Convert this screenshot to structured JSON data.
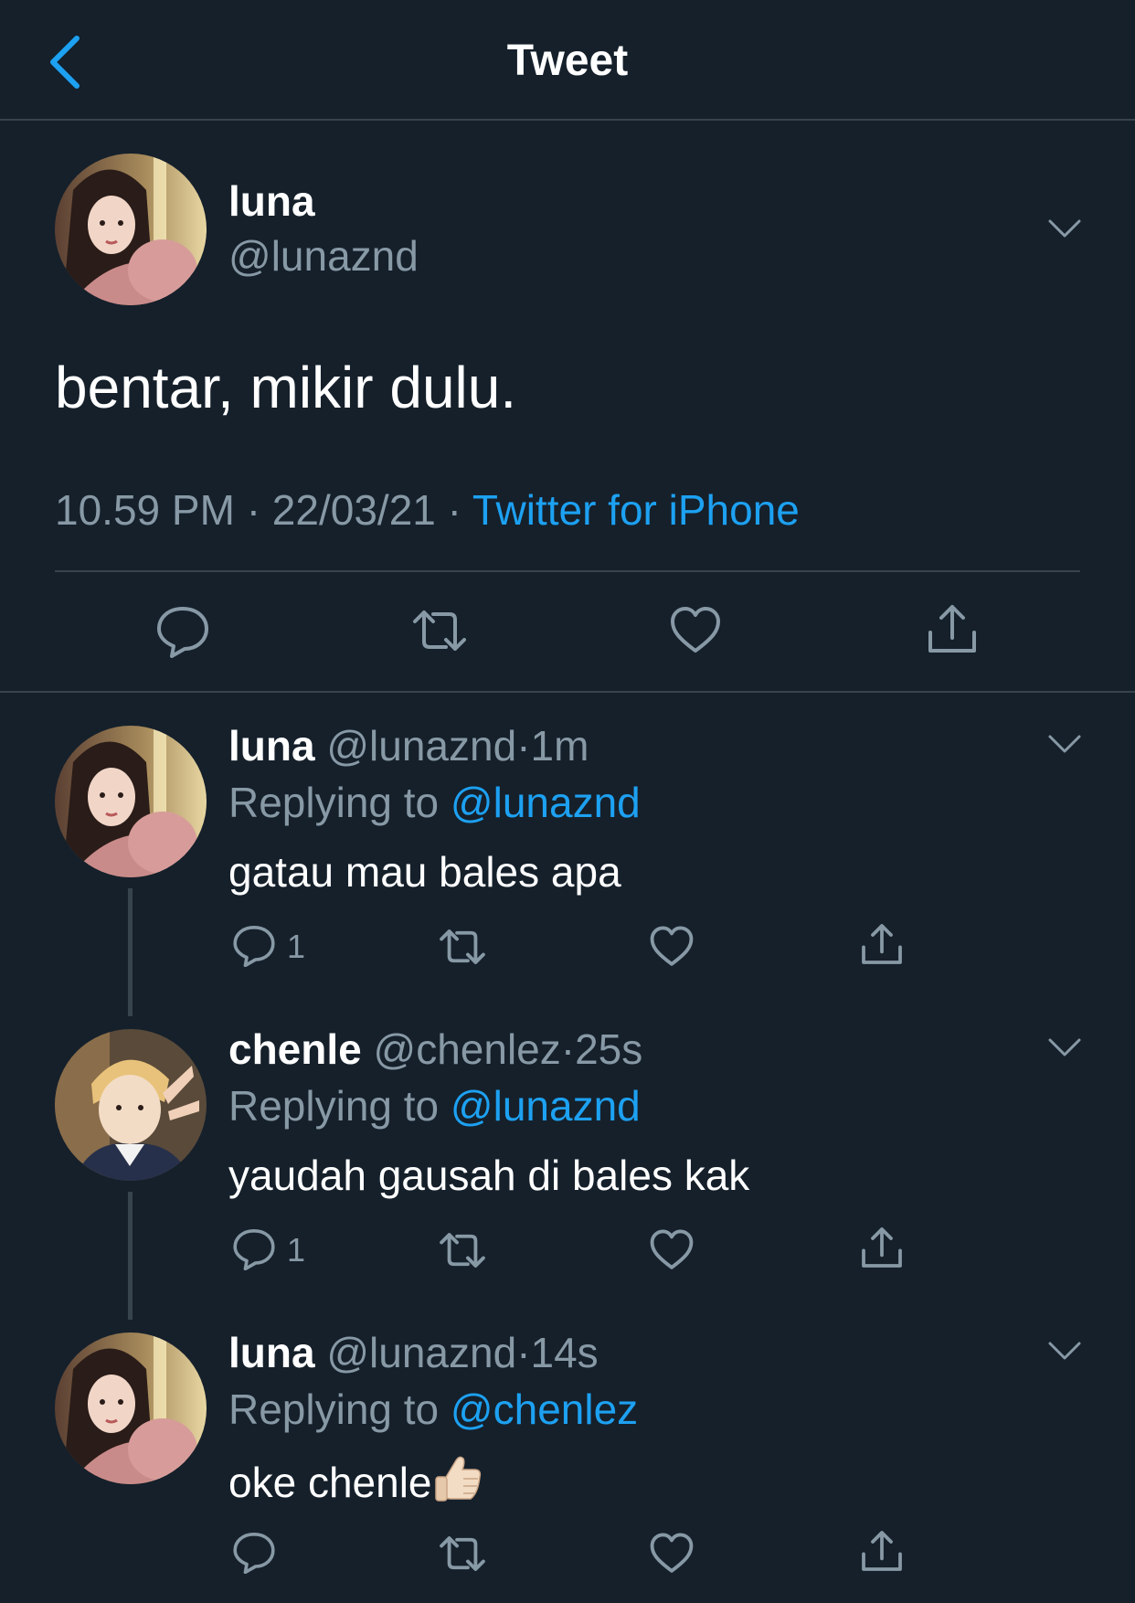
{
  "header": {
    "title": "Tweet",
    "back_icon": "chevron-left-icon"
  },
  "main_tweet": {
    "display_name": "luna",
    "handle": "@lunaznd",
    "text": "bentar, mikir dulu.",
    "time": "10.59 PM",
    "date": "22/03/21",
    "source": "Twitter for iPhone",
    "dot": "·"
  },
  "replies": [
    {
      "display_name": "luna",
      "handle": "@lunaznd",
      "time": "1m",
      "replying_label": "Replying to",
      "replying_to": "@lunaznd",
      "text": "gatau mau bales apa",
      "reply_count": "1"
    },
    {
      "display_name": "chenle",
      "handle": "@chenlez",
      "time": "25s",
      "replying_label": "Replying to",
      "replying_to": "@lunaznd",
      "text": "yaudah gausah di bales kak",
      "reply_count": "1"
    },
    {
      "display_name": "luna",
      "handle": "@lunaznd",
      "time": "14s",
      "replying_label": "Replying to",
      "replying_to": "@chenlez",
      "text": "oke chenle",
      "emoji": "thumbs-up",
      "reply_count": ""
    }
  ],
  "colors": {
    "background": "#15202b",
    "divider": "#38444d",
    "muted_text": "#8899a6",
    "accent": "#1da1f2",
    "text": "#ffffff"
  }
}
